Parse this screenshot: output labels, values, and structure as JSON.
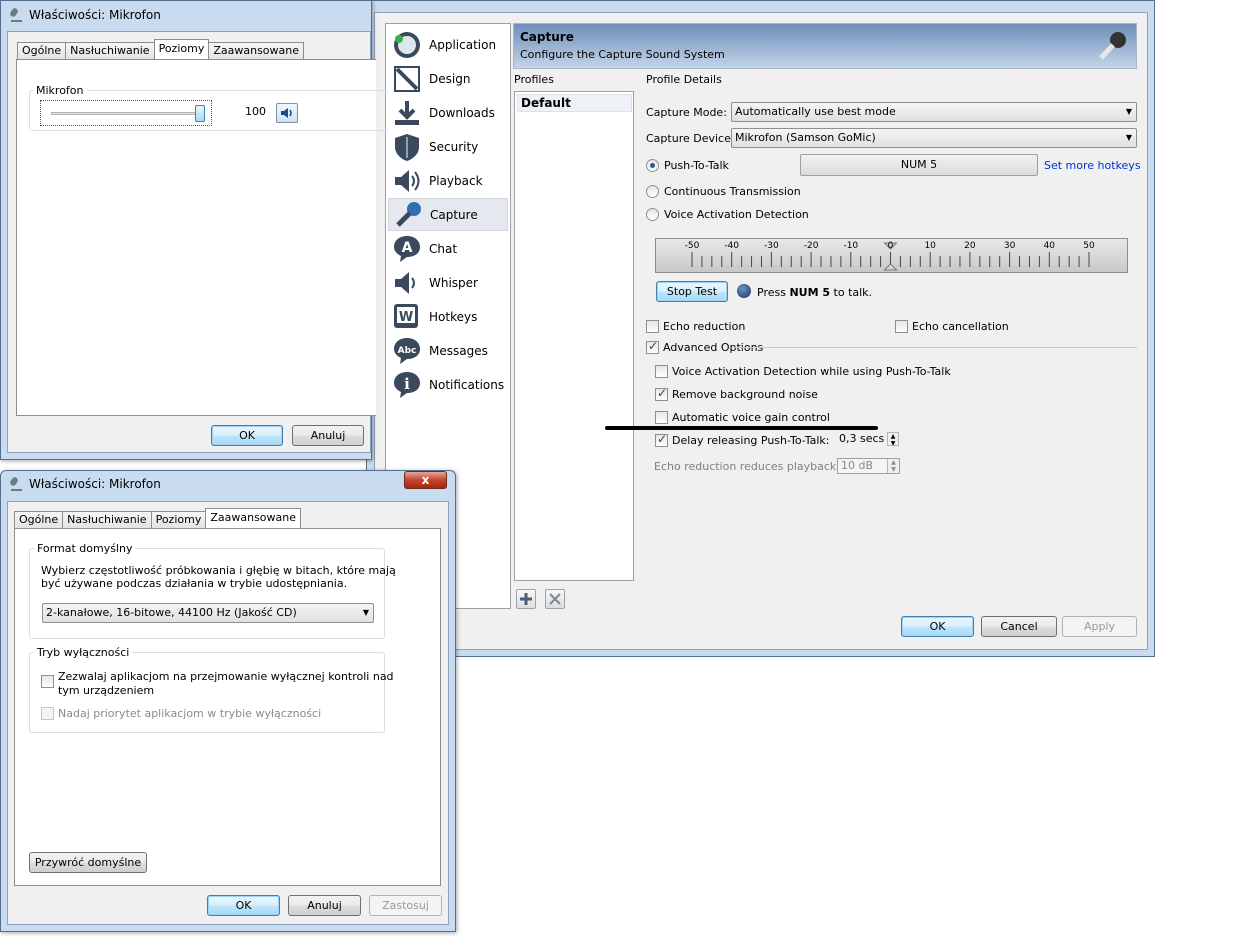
{
  "win1": {
    "title": "Właściwości: Mikrofon",
    "tabs": [
      "Ogólne",
      "Nasłuchiwanie",
      "Poziomy",
      "Zaawansowane"
    ],
    "group_label": "Mikrofon",
    "level_value": "100",
    "level_fraction": 1.0,
    "ok": "OK",
    "cancel": "Anuluj"
  },
  "ts": {
    "nav": [
      {
        "label": "Application",
        "icon": "application-icon"
      },
      {
        "label": "Design",
        "icon": "design-icon"
      },
      {
        "label": "Downloads",
        "icon": "downloads-icon"
      },
      {
        "label": "Security",
        "icon": "security-icon"
      },
      {
        "label": "Playback",
        "icon": "playback-icon"
      },
      {
        "label": "Capture",
        "icon": "capture-icon"
      },
      {
        "label": "Chat",
        "icon": "chat-icon"
      },
      {
        "label": "Whisper",
        "icon": "whisper-icon"
      },
      {
        "label": "Hotkeys",
        "icon": "hotkeys-icon"
      },
      {
        "label": "Messages",
        "icon": "messages-icon"
      },
      {
        "label": "Notifications",
        "icon": "notifications-icon"
      }
    ],
    "selected_nav": "Capture",
    "header": {
      "title": "Capture",
      "subtitle": "Configure the Capture Sound System"
    },
    "profiles_label": "Profiles",
    "profile_details_label": "Profile Details",
    "profiles": [
      "Default"
    ],
    "capture_mode_label": "Capture Mode:",
    "capture_mode_value": "Automatically use best mode",
    "capture_device_label": "Capture Device:",
    "capture_device_value": "Mikrofon (Samson GoMic)",
    "ptt_label": "Push-To-Talk",
    "ptt_hotkey": "NUM 5",
    "more_hotkeys": "Set more hotkeys",
    "continuous_label": "Continuous Transmission",
    "vad_label": "Voice Activation Detection",
    "ruler_ticks": [
      "-50",
      "-40",
      "-30",
      "-20",
      "-10",
      "0",
      "10",
      "20",
      "30",
      "40",
      "50"
    ],
    "stop_test": "Stop Test",
    "press_prefix": "Press ",
    "press_key": "NUM 5",
    "press_suffix": " to talk.",
    "echo_reduction": "Echo reduction",
    "echo_cancellation": "Echo cancellation",
    "advanced_options": "Advanced Options",
    "vad_while_ptt": "Voice Activation Detection while using Push-To-Talk",
    "remove_noise": "Remove background noise",
    "auto_gain": "Automatic voice gain control",
    "delay_release": "Delay releasing Push-To-Talk:",
    "delay_value": "0,3 secs",
    "echo_playback_label": "Echo reduction reduces playback by:",
    "echo_playback_value": "10 dB",
    "ok": "OK",
    "cancel": "Cancel",
    "apply": "Apply"
  },
  "win2": {
    "title": "Właściwości: Mikrofon",
    "tabs": [
      "Ogólne",
      "Nasłuchiwanie",
      "Poziomy",
      "Zaawansowane"
    ],
    "format_group": "Format domyślny",
    "format_desc_1": "Wybierz częstotliwość próbkowania i głębię w bitach, które mają",
    "format_desc_2": "być używane podczas działania w trybie udostępniania.",
    "format_value": "2-kanałowe, 16-bitowe, 44100 Hz (Jakość CD)",
    "exclusive_group": "Tryb wyłączności",
    "exclusive_1a": "Zezwalaj aplikacjom na przejmowanie wyłącznej kontroli nad",
    "exclusive_1b": "tym urządzeniem",
    "exclusive_2": "Nadaj priorytet aplikacjom w trybie wyłączności",
    "restore": "Przywróć domyślne",
    "ok": "OK",
    "cancel": "Anuluj",
    "apply": "Zastosuj",
    "close": "x"
  }
}
